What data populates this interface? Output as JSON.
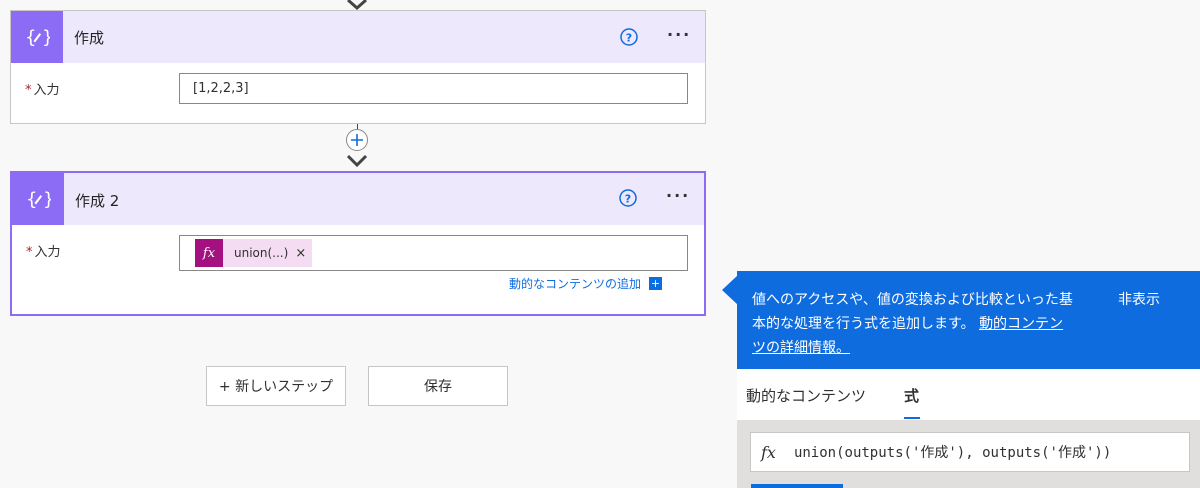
{
  "card1": {
    "title": "作成",
    "input_label": "入力",
    "required_mark": "*",
    "input_value": "[1,2,2,3]"
  },
  "card2": {
    "title": "作成 2",
    "input_label": "入力",
    "required_mark": "*",
    "token_icon": "fx",
    "token_label": "union(...)",
    "token_remove": "×",
    "add_dynamic_label": "動的なコンテンツの追加"
  },
  "buttons": {
    "new_step": "+ 新しいステップ",
    "save": "保存"
  },
  "panel": {
    "description_1": "値へのアクセスや、値の変換および比較といった基",
    "description_2": "本的な処理を行う式を追加します。",
    "link_1": "動的コンテン",
    "link_2": "ツの詳細情報。",
    "hide_label": "非表示",
    "tab_dynamic": "動的なコンテンツ",
    "tab_expression": "式",
    "expression_icon": "fx",
    "expression_value": "union(outputs('作成'), outputs('作成'))"
  },
  "colors": {
    "accent_purple": "#8c6cf5",
    "header_purple": "#ede8fb",
    "panel_blue": "#0f6cde",
    "token_magenta": "#a4107f"
  }
}
